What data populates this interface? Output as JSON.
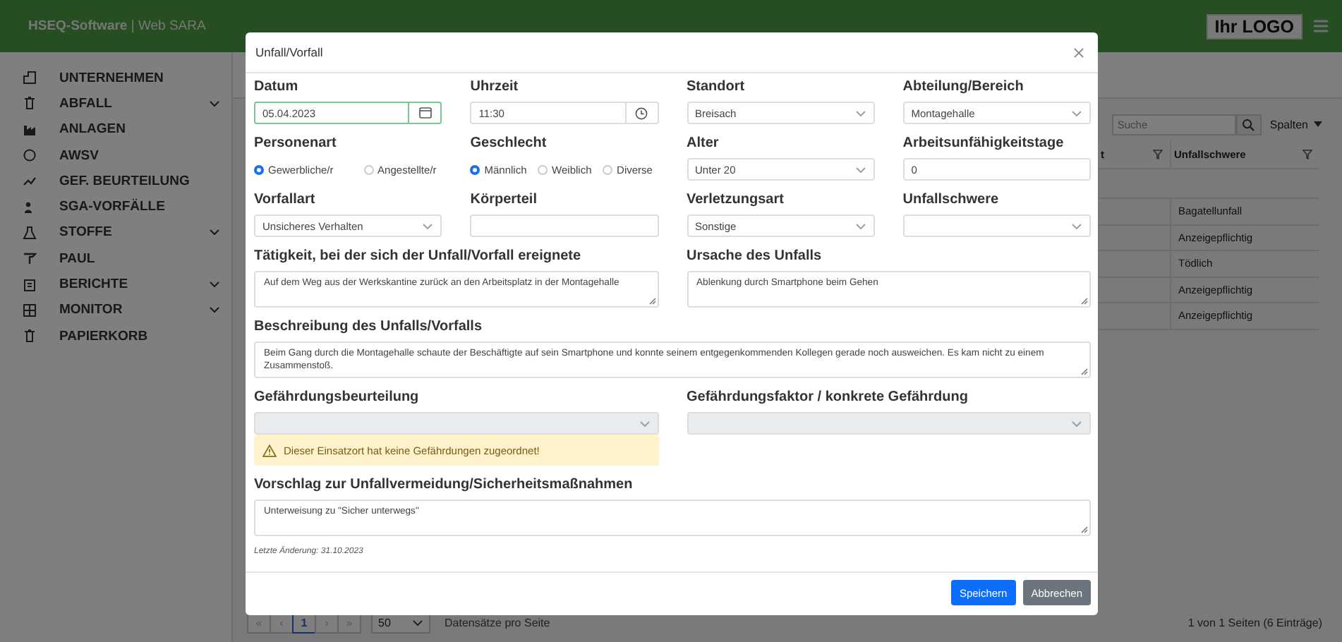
{
  "header": {
    "title": "**HSEQ-Software** | Web SARA",
    "logo": "Ihr LOGO"
  },
  "sidebar": {
    "items": [
      {
        "label": "UNTERNEHMEN",
        "expandable": false
      },
      {
        "label": "ABFALL",
        "expandable": true
      },
      {
        "label": "ANLAGEN",
        "expandable": false
      },
      {
        "label": "AWSV",
        "expandable": false
      },
      {
        "label": "GEF. BEURTEILUNG",
        "expandable": false
      },
      {
        "label": "SGA-VORFÄLLE",
        "expandable": false
      },
      {
        "label": "STOFFE",
        "expandable": true
      },
      {
        "label": "PAUL",
        "expandable": false
      },
      {
        "label": "BERICHTE",
        "expandable": true
      },
      {
        "label": "MONITOR",
        "expandable": true
      },
      {
        "label": "PAPIERKORB",
        "expandable": false
      }
    ]
  },
  "list": {
    "search": {
      "placeholder": "Suche"
    },
    "columns_button": "Spalten",
    "table": {
      "columns": [
        {
          "label": "t"
        },
        {
          "label": "Unfallschwere"
        }
      ],
      "rows": [
        {
          "column_2": "Bagatellunfall"
        },
        {
          "column_2": "Anzeigepflichtig"
        },
        {
          "column_2": "Tödlich"
        },
        {
          "column_2": "Anzeigepflichtig"
        },
        {
          "column_2": "Anzeigepflichtig"
        }
      ]
    },
    "pagination": {
      "buttons": [
        {
          "label": "«",
          "selected": false,
          "disabled": true
        },
        {
          "label": "‹",
          "selected": false,
          "disabled": true
        },
        {
          "label": "1",
          "selected": true,
          "disabled": false
        },
        {
          "label": "›",
          "selected": false,
          "disabled": true
        },
        {
          "label": "»",
          "selected": false,
          "disabled": true
        }
      ],
      "page_size": "50",
      "page_size_label": "Datensätze pro Seite",
      "summary": "1 von 1 Seiten (6 Einträge)"
    }
  },
  "modal": {
    "title": "Unfall/Vorfall",
    "rows": [
      {
        "fields": [
          {
            "kind": "date",
            "label": "Datum",
            "value": "05.04.2023",
            "focused": true,
            "disabled": false
          },
          {
            "kind": "time",
            "label": "Uhrzeit",
            "value": "11:30",
            "focused": false,
            "disabled": false
          },
          {
            "kind": "select",
            "label": "Standort",
            "value": "Breisach",
            "focused": false,
            "disabled": false
          },
          {
            "kind": "select",
            "label": "Abteilung/Bereich",
            "value": "Montagehalle",
            "focused": false,
            "disabled": false
          }
        ]
      },
      {
        "fields": [
          {
            "kind": "radio",
            "label": "Personenart",
            "options": [
              {
                "label": "Gewerbliche/r",
                "selected": true
              },
              {
                "label": "Angestellte/r",
                "selected": false
              }
            ]
          },
          {
            "kind": "radio",
            "label": "Geschlecht",
            "options": [
              {
                "label": "Männlich",
                "selected": true
              },
              {
                "label": "Weiblich",
                "selected": false
              },
              {
                "label": "Diverse",
                "selected": false
              }
            ]
          },
          {
            "kind": "select",
            "label": "Alter",
            "value": "Unter 20",
            "focused": false,
            "disabled": false
          },
          {
            "kind": "text",
            "label": "Arbeitsunfähigkeitstage",
            "value": "0",
            "focused": false,
            "disabled": false
          }
        ]
      },
      {
        "fields": [
          {
            "kind": "select",
            "label": "Vorfallart",
            "value": "Unsicheres Verhalten",
            "focused": false,
            "disabled": false
          },
          {
            "kind": "text",
            "label": "Körperteil",
            "focused": false,
            "disabled": false
          },
          {
            "kind": "select",
            "label": "Verletzungsart",
            "value": "Sonstige",
            "focused": false,
            "disabled": false
          },
          {
            "kind": "select",
            "label": "Unfallschwere",
            "focused": false,
            "disabled": false
          }
        ]
      },
      {
        "fields": [
          {
            "kind": "textarea",
            "label": "Tätigkeit, bei der sich der Unfall/Vorfall ereignete",
            "value": "Auf dem Weg aus der Werkskantine zurück an den Arbeitsplatz in der Montagehalle",
            "focused": false,
            "disabled": false
          },
          {
            "kind": "textarea",
            "label": "Ursache des Unfalls",
            "value": "Ablenkung durch Smartphone beim Gehen",
            "focused": false,
            "disabled": false
          }
        ]
      },
      {
        "fields": [
          {
            "kind": "textarea",
            "label": "Beschreibung des Unfalls/Vorfalls",
            "value": "Beim Gang durch die Montagehalle schaute der Beschäftigte auf sein Smartphone und konnte seinem entgegenkommenden Kollegen gerade noch ausweichen. Es kam nicht zu einem Zusammenstoß.",
            "focused": false,
            "disabled": false
          }
        ]
      },
      {
        "fields": [
          {
            "kind": "select",
            "label": "Gefährdungsbeurteilung",
            "focused": false,
            "disabled": true,
            "warning": "Dieser Einsatzort hat keine Gefährdungen zugeordnet!"
          },
          {
            "kind": "select",
            "label": "Gefährdungsfaktor / konkrete Gefährdung",
            "focused": false,
            "disabled": true
          }
        ]
      },
      {
        "fields": [
          {
            "kind": "textarea",
            "label": "Vorschlag zur Unfallvermeidung/Sicherheitsmaßnahmen",
            "value": "Unterweisung zu \"Sicher unterwegs\"",
            "focused": false,
            "disabled": false
          }
        ]
      }
    ],
    "last_change": "Letzte Änderung: 31.10.2023",
    "buttons": [
      {
        "label": "Speichern",
        "kind": "primary"
      },
      {
        "label": "Abbrechen",
        "kind": "secondary"
      }
    ]
  }
}
